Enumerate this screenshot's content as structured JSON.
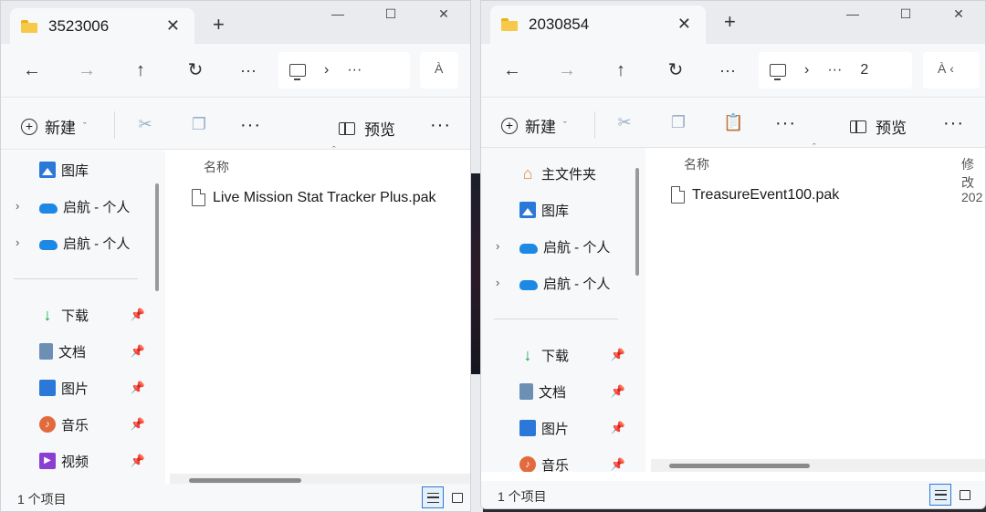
{
  "left_window": {
    "tab_title": "3523006",
    "tab_close": "✕",
    "new_tab": "+",
    "window_controls": {
      "minimize": "—",
      "maximize": "☐",
      "close": "✕"
    },
    "nav": {
      "back": "←",
      "forward": "→",
      "up": "↑",
      "refresh": "↻",
      "more": "···"
    },
    "path": {
      "chevron": "›",
      "ellipsis": "···"
    },
    "search_partial": "À",
    "toolbar": {
      "new_label": "新建",
      "preview_label": "预览",
      "more": "···",
      "overflow": "···"
    },
    "sidebar": {
      "items": [
        {
          "label": "图库",
          "icon": "gallery-icon",
          "expandable": false,
          "pinned": false
        },
        {
          "label": "启航 - 个人",
          "icon": "cloud-icon",
          "expandable": true,
          "pinned": false
        },
        {
          "label": "启航 - 个人",
          "icon": "cloud-icon",
          "expandable": true,
          "pinned": false
        },
        {
          "label": "下载",
          "icon": "download-icon",
          "expandable": false,
          "pinned": true
        },
        {
          "label": "文档",
          "icon": "document-icon",
          "expandable": false,
          "pinned": true
        },
        {
          "label": "图片",
          "icon": "pictures-icon",
          "expandable": false,
          "pinned": true
        },
        {
          "label": "音乐",
          "icon": "music-icon",
          "expandable": false,
          "pinned": true
        },
        {
          "label": "视频",
          "icon": "video-icon",
          "expandable": false,
          "pinned": true
        }
      ]
    },
    "content": {
      "column_name": "名称",
      "files": [
        {
          "name": "Live Mission Stat Tracker Plus.pak",
          "icon": "file-icon"
        }
      ]
    },
    "status": {
      "count": "1 个项目"
    }
  },
  "right_window": {
    "tab_title": "2030854",
    "tab_close": "✕",
    "new_tab": "+",
    "window_controls": {
      "minimize": "—",
      "maximize": "☐",
      "close": "✕"
    },
    "nav": {
      "back": "←",
      "forward": "→",
      "up": "↑",
      "refresh": "↻",
      "more": "···"
    },
    "path": {
      "chevron": "›",
      "ellipsis": "···",
      "partial": "2"
    },
    "search_partial": "À ‹",
    "toolbar": {
      "new_label": "新建",
      "preview_label": "预览",
      "more": "···",
      "overflow": "···"
    },
    "sidebar": {
      "items": [
        {
          "label": "主文件夹",
          "icon": "home-icon",
          "expandable": false,
          "pinned": false
        },
        {
          "label": "图库",
          "icon": "gallery-icon",
          "expandable": false,
          "pinned": false
        },
        {
          "label": "启航 - 个人",
          "icon": "cloud-icon",
          "expandable": true,
          "pinned": false
        },
        {
          "label": "启航 - 个人",
          "icon": "cloud-icon",
          "expandable": true,
          "pinned": false
        },
        {
          "label": "下载",
          "icon": "download-icon",
          "expandable": false,
          "pinned": true
        },
        {
          "label": "文档",
          "icon": "document-icon",
          "expandable": false,
          "pinned": true
        },
        {
          "label": "图片",
          "icon": "pictures-icon",
          "expandable": false,
          "pinned": true
        },
        {
          "label": "音乐",
          "icon": "music-icon",
          "expandable": false,
          "pinned": true
        }
      ]
    },
    "content": {
      "column_name": "名称",
      "column_modified": "修改",
      "files": [
        {
          "name": "TreasureEvent100.pak",
          "icon": "file-icon",
          "modified_partial": "202"
        }
      ]
    },
    "status": {
      "count": "1 个项目"
    }
  }
}
